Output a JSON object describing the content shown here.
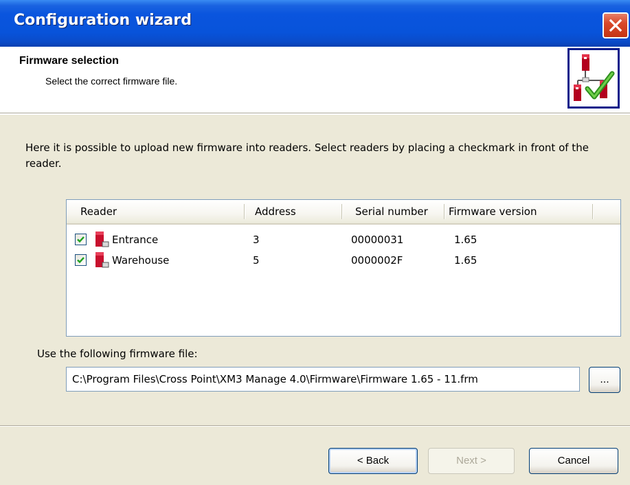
{
  "window": {
    "title": "Configuration wizard"
  },
  "header": {
    "title": "Firmware selection",
    "subtitle": "Select the correct firmware file.",
    "icon": "reader-checkmark-icon"
  },
  "intro_text": "Here it is possible to upload new firmware into readers. Select readers by placing a checkmark in front of the reader.",
  "readers_table": {
    "columns": [
      "Reader",
      "Address",
      "Serial number",
      "Firmware version"
    ],
    "rows": [
      {
        "checked": true,
        "reader": "Entrance",
        "address": "3",
        "serial": "00000031",
        "firmware": "1.65"
      },
      {
        "checked": true,
        "reader": "Warehouse",
        "address": "5",
        "serial": "0000002F",
        "firmware": "1.65"
      }
    ]
  },
  "firmware_file": {
    "label": "Use the following firmware file:",
    "value": "C:\\Program Files\\Cross Point\\XM3 Manage 4.0\\Firmware\\Firmware 1.65 - 11.frm",
    "browse_label": "..."
  },
  "buttons": {
    "back": "< Back",
    "next": "Next >",
    "cancel": "Cancel"
  },
  "colors": {
    "titlebar": "#0853da",
    "dialog_bg": "#ece9d8",
    "check": "#21a121",
    "reader_red": "#c8102e"
  }
}
